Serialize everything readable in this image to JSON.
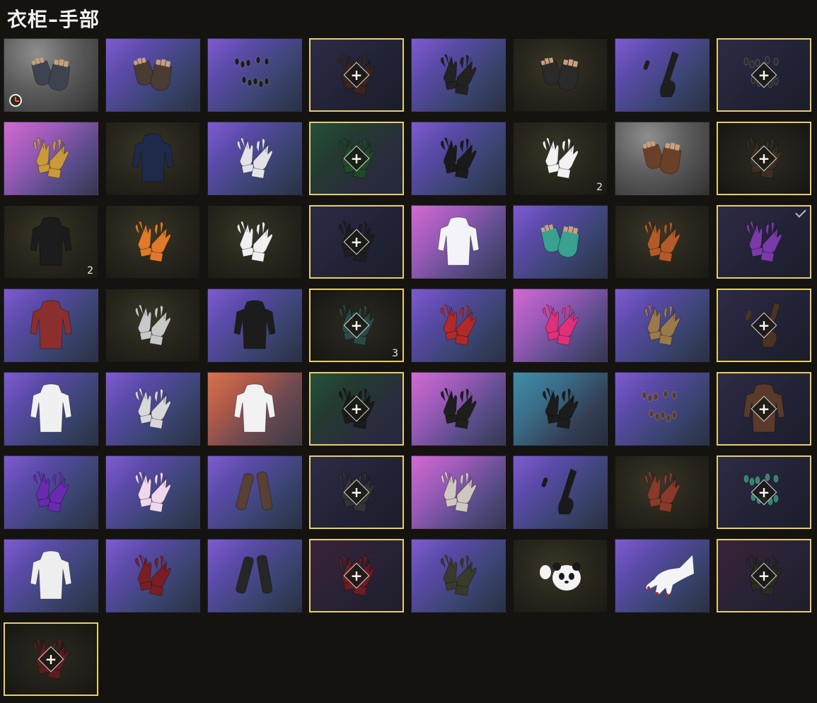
{
  "page": {
    "title": "衣柜–手部"
  },
  "theme": {
    "selected_border": "#e6cf6a",
    "background": "#15130f"
  },
  "add_symbol": "+",
  "items": [
    {
      "bg": "gray",
      "icon": "fingerless-gloves-icon",
      "color": "#3d4450",
      "selected": false,
      "add": false,
      "count": "",
      "clock": true,
      "check": false
    },
    {
      "bg": "purple",
      "icon": "fingerless-gloves-icon",
      "color": "#4a3c33",
      "selected": false,
      "add": false,
      "count": "",
      "clock": false,
      "check": false
    },
    {
      "bg": "purple",
      "icon": "nail-set-icon",
      "color": "#1a1a1a",
      "selected": false,
      "add": false,
      "count": "",
      "clock": false,
      "check": false
    },
    {
      "bg": "empty",
      "icon": "gloves-icon",
      "color": "#3b241e",
      "selected": true,
      "add": true,
      "count": "",
      "clock": false,
      "check": false
    },
    {
      "bg": "purple",
      "icon": "gloves-icon",
      "color": "#222222",
      "selected": false,
      "add": false,
      "count": "",
      "clock": false,
      "check": false
    },
    {
      "bg": "dark",
      "icon": "fingerless-gloves-icon",
      "color": "#2a2a2a",
      "selected": false,
      "add": false,
      "count": "",
      "clock": false,
      "check": false
    },
    {
      "bg": "purple",
      "icon": "long-glove-icon",
      "color": "#1e1e1e",
      "selected": false,
      "add": false,
      "count": "",
      "clock": false,
      "check": false
    },
    {
      "bg": "empty",
      "icon": "nail-set-icon",
      "color": "#2a2a2a",
      "selected": true,
      "add": true,
      "count": "",
      "clock": false,
      "check": false
    },
    {
      "bg": "pink",
      "icon": "gloves-icon",
      "color": "#c89a3a",
      "selected": false,
      "add": false,
      "count": "",
      "clock": false,
      "check": false
    },
    {
      "bg": "dark",
      "icon": "outfit-icon",
      "color": "#1f2a4a",
      "selected": false,
      "add": false,
      "count": "",
      "clock": false,
      "check": false
    },
    {
      "bg": "purple",
      "icon": "gloves-icon",
      "color": "#e2e2e8",
      "selected": false,
      "add": false,
      "count": "",
      "clock": false,
      "check": false
    },
    {
      "bg": "greendark",
      "icon": "gloves-icon",
      "color": "#1e4a28",
      "selected": true,
      "add": true,
      "count": "",
      "clock": false,
      "check": false
    },
    {
      "bg": "purple",
      "icon": "gloves-icon",
      "color": "#1a1a1a",
      "selected": false,
      "add": false,
      "count": "",
      "clock": false,
      "check": false
    },
    {
      "bg": "dark",
      "icon": "gloves-icon",
      "color": "#f2f2f2",
      "selected": false,
      "add": false,
      "count": "2",
      "clock": false,
      "check": false
    },
    {
      "bg": "gray",
      "icon": "fingerless-gloves-icon",
      "color": "#6a4028",
      "selected": false,
      "add": false,
      "count": "",
      "clock": false,
      "check": false
    },
    {
      "bg": "emptydark",
      "icon": "gloves-icon",
      "color": "#3a2f22",
      "selected": true,
      "add": true,
      "count": "",
      "clock": false,
      "check": false
    },
    {
      "bg": "dark",
      "icon": "outfit-icon",
      "color": "#1c1c1c",
      "selected": false,
      "add": false,
      "count": "2",
      "clock": false,
      "check": false
    },
    {
      "bg": "dark",
      "icon": "gloves-icon",
      "color": "#e07a2a",
      "selected": false,
      "add": false,
      "count": "",
      "clock": false,
      "check": false
    },
    {
      "bg": "dark",
      "icon": "gloves-icon",
      "color": "#f0f0f0",
      "selected": false,
      "add": false,
      "count": "",
      "clock": false,
      "check": false
    },
    {
      "bg": "empty",
      "icon": "gloves-icon",
      "color": "#1e1e1e",
      "selected": true,
      "add": true,
      "count": "",
      "clock": false,
      "check": false
    },
    {
      "bg": "pink",
      "icon": "outfit-icon",
      "color": "#f4f4f8",
      "selected": false,
      "add": false,
      "count": "",
      "clock": false,
      "check": false
    },
    {
      "bg": "purple",
      "icon": "fingerless-gloves-icon",
      "color": "#3aa090",
      "selected": false,
      "add": false,
      "count": "",
      "clock": false,
      "check": false
    },
    {
      "bg": "dark",
      "icon": "gloves-icon",
      "color": "#b45a28",
      "selected": false,
      "add": false,
      "count": "",
      "clock": false,
      "check": false
    },
    {
      "bg": "empty",
      "icon": "gloves-icon",
      "color": "#7a3aa8",
      "selected": true,
      "add": false,
      "count": "",
      "clock": false,
      "check": true
    },
    {
      "bg": "purple",
      "icon": "outfit-icon",
      "color": "#8a2e2e",
      "selected": false,
      "add": false,
      "count": "",
      "clock": false,
      "check": false
    },
    {
      "bg": "dark",
      "icon": "gloves-icon",
      "color": "#c8c8c8",
      "selected": false,
      "add": false,
      "count": "",
      "clock": false,
      "check": false
    },
    {
      "bg": "purple",
      "icon": "outfit-icon",
      "color": "#1c1c1c",
      "selected": false,
      "add": false,
      "count": "",
      "clock": false,
      "check": false
    },
    {
      "bg": "emptydark",
      "icon": "gloves-icon",
      "color": "#2a4a48",
      "selected": true,
      "add": true,
      "count": "3",
      "clock": false,
      "check": false
    },
    {
      "bg": "purple",
      "icon": "gloves-icon",
      "color": "#b02a2a",
      "selected": false,
      "add": false,
      "count": "",
      "clock": false,
      "check": false
    },
    {
      "bg": "pink",
      "icon": "gloves-icon",
      "color": "#e0307a",
      "selected": false,
      "add": false,
      "count": "",
      "clock": false,
      "check": false
    },
    {
      "bg": "purple",
      "icon": "gloves-icon",
      "color": "#9a7a4a",
      "selected": false,
      "add": false,
      "count": "",
      "clock": false,
      "check": false
    },
    {
      "bg": "empty",
      "icon": "long-glove-icon",
      "color": "#4a3224",
      "selected": true,
      "add": true,
      "count": "",
      "clock": false,
      "check": false
    },
    {
      "bg": "purple",
      "icon": "outfit-icon",
      "color": "#f0f0f0",
      "selected": false,
      "add": false,
      "count": "",
      "clock": false,
      "check": false
    },
    {
      "bg": "purple",
      "icon": "gloves-icon",
      "color": "#d8d8dc",
      "selected": false,
      "add": false,
      "count": "",
      "clock": false,
      "check": false
    },
    {
      "bg": "orange",
      "icon": "outfit-icon",
      "color": "#f2f2f2",
      "selected": false,
      "add": false,
      "count": "",
      "clock": false,
      "check": false
    },
    {
      "bg": "greendark",
      "icon": "gloves-icon",
      "color": "#1a1a1a",
      "selected": true,
      "add": true,
      "count": "",
      "clock": false,
      "check": false
    },
    {
      "bg": "pink",
      "icon": "gloves-icon",
      "color": "#1e1e1e",
      "selected": false,
      "add": false,
      "count": "",
      "clock": false,
      "check": false
    },
    {
      "bg": "teal",
      "icon": "gloves-icon",
      "color": "#1c1c1c",
      "selected": false,
      "add": false,
      "count": "",
      "clock": false,
      "check": false
    },
    {
      "bg": "purple",
      "icon": "nail-set-icon",
      "color": "#5a3a28",
      "selected": false,
      "add": false,
      "count": "",
      "clock": false,
      "check": false
    },
    {
      "bg": "empty",
      "icon": "outfit-icon",
      "color": "#5a3a2a",
      "selected": true,
      "add": true,
      "count": "",
      "clock": false,
      "check": false
    },
    {
      "bg": "purple",
      "icon": "gloves-icon",
      "color": "#6a2ab0",
      "selected": false,
      "add": false,
      "count": "",
      "clock": false,
      "check": false
    },
    {
      "bg": "purple",
      "icon": "gloves-icon",
      "color": "#f0d8ec",
      "selected": false,
      "add": false,
      "count": "",
      "clock": false,
      "check": false
    },
    {
      "bg": "purple",
      "icon": "arm-wraps-icon",
      "color": "#5a4034",
      "selected": false,
      "add": false,
      "count": "",
      "clock": false,
      "check": false
    },
    {
      "bg": "empty",
      "icon": "gloves-icon",
      "color": "#333333",
      "selected": true,
      "add": true,
      "count": "",
      "clock": false,
      "check": false
    },
    {
      "bg": "pink",
      "icon": "gloves-icon",
      "color": "#d0c8c0",
      "selected": false,
      "add": false,
      "count": "",
      "clock": false,
      "check": false
    },
    {
      "bg": "purple",
      "icon": "long-glove-icon",
      "color": "#1a1a1a",
      "selected": false,
      "add": false,
      "count": "",
      "clock": false,
      "check": false
    },
    {
      "bg": "dark",
      "icon": "gloves-icon",
      "color": "#8a3a2a",
      "selected": false,
      "add": false,
      "count": "",
      "clock": false,
      "check": false
    },
    {
      "bg": "empty",
      "icon": "nail-set-icon",
      "color": "#2a8a6a",
      "selected": true,
      "add": true,
      "count": "",
      "clock": false,
      "check": false
    },
    {
      "bg": "purple",
      "icon": "outfit-icon",
      "color": "#eeeeee",
      "selected": false,
      "add": false,
      "count": "",
      "clock": false,
      "check": false
    },
    {
      "bg": "purple",
      "icon": "gloves-icon",
      "color": "#7a1e24",
      "selected": false,
      "add": false,
      "count": "",
      "clock": false,
      "check": false
    },
    {
      "bg": "purple",
      "icon": "arm-wraps-icon",
      "color": "#262626",
      "selected": false,
      "add": false,
      "count": "",
      "clock": false,
      "check": false
    },
    {
      "bg": "emptyred",
      "icon": "gloves-icon",
      "color": "#6a1e22",
      "selected": true,
      "add": true,
      "count": "",
      "clock": false,
      "check": false
    },
    {
      "bg": "purple",
      "icon": "gloves-icon",
      "color": "#3a3a2a",
      "selected": false,
      "add": false,
      "count": "",
      "clock": false,
      "check": false
    },
    {
      "bg": "dark",
      "icon": "panda-mitten-icon",
      "color": "#f4f4f4",
      "selected": false,
      "add": false,
      "count": "",
      "clock": false,
      "check": false
    },
    {
      "bg": "purple",
      "icon": "hand-icon",
      "color": "#f4f4f4",
      "selected": false,
      "add": false,
      "count": "",
      "clock": false,
      "check": false
    },
    {
      "bg": "emptyred",
      "icon": "gloves-icon",
      "color": "#2a2a22",
      "selected": true,
      "add": true,
      "count": "",
      "clock": false,
      "check": false
    },
    {
      "bg": "emptydark",
      "icon": "gloves-icon",
      "color": "#5a1e1e",
      "selected": true,
      "add": true,
      "count": "",
      "clock": false,
      "check": false
    }
  ]
}
